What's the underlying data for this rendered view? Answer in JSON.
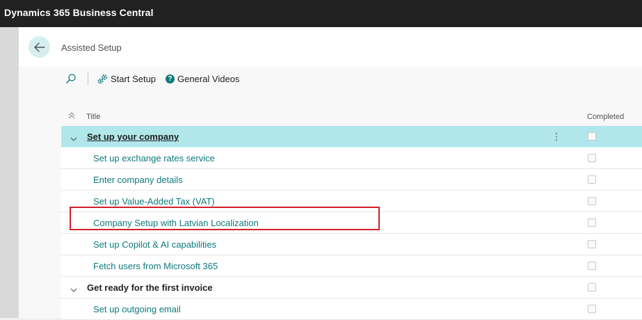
{
  "app": {
    "title": "Dynamics 365 Business Central"
  },
  "page": {
    "title": "Assisted Setup"
  },
  "toolbar": {
    "start_setup_label": "Start Setup",
    "general_videos_label": "General Videos",
    "general_videos_icon_text": "?"
  },
  "grid": {
    "header": {
      "title": "Title",
      "completed": "Completed"
    },
    "rows": [
      {
        "type": "group",
        "label": "Set up your company",
        "selected": true
      },
      {
        "type": "item",
        "label": "Set up exchange rates service"
      },
      {
        "type": "item",
        "label": "Enter company details"
      },
      {
        "type": "item",
        "label": "Set up Value-Added Tax (VAT)"
      },
      {
        "type": "item",
        "label": "Company Setup with Latvian Localization"
      },
      {
        "type": "item",
        "label": "Set up Copilot & AI capabilities"
      },
      {
        "type": "item",
        "label": "Fetch users from Microsoft 365"
      },
      {
        "type": "group",
        "label": "Get ready for the first invoice"
      },
      {
        "type": "item",
        "label": "Set up outgoing email"
      }
    ],
    "more_glyph": "⋮"
  },
  "colors": {
    "accent": "#0e7a7d",
    "selected_row": "#b1e7ea",
    "highlight": "#d11f2a",
    "topbar": "#212121"
  }
}
